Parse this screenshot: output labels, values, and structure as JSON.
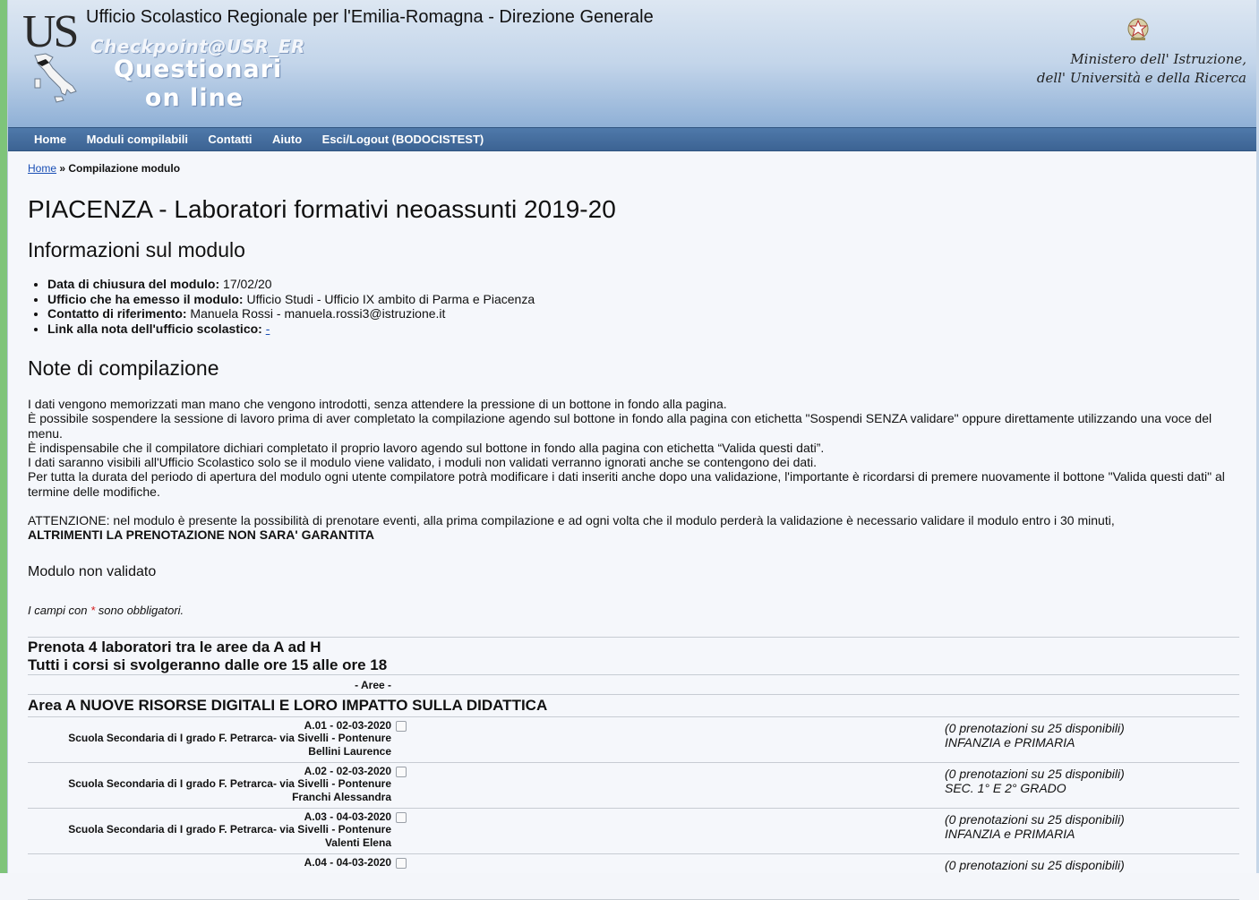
{
  "header": {
    "logo": "US",
    "title": "Ufficio Scolastico Regionale per l'Emilia-Romagna - Direzione Generale",
    "checkpoint": "Checkpoint@USR_ER",
    "questionari_line1": "Questionari",
    "questionari_line2": "on line",
    "ministero_line1": "Ministero dell' Istruzione,",
    "ministero_line2": "dell' Università e della Ricerca"
  },
  "nav": {
    "items": [
      "Home",
      "Moduli compilabili",
      "Contatti",
      "Aiuto",
      "Esci/Logout (BODOCISTEST)"
    ]
  },
  "breadcrumb": {
    "home": "Home",
    "separator": " » ",
    "current": "Compilazione modulo"
  },
  "page_title": "PIACENZA - Laboratori formativi neoassunti 2019-20",
  "info": {
    "heading": "Informazioni sul modulo",
    "items": [
      {
        "label": "Data di chiusura del modulo:",
        "value": " 17/02/20"
      },
      {
        "label": "Ufficio che ha emesso il modulo:",
        "value": " Ufficio Studi - Ufficio IX ambito di Parma e Piacenza"
      },
      {
        "label": "Contatto di riferimento:",
        "value": " Manuela Rossi - manuela.rossi3@istruzione.it"
      },
      {
        "label": "Link alla nota dell'ufficio scolastico:",
        "value": " ",
        "link": "-"
      }
    ]
  },
  "notes": {
    "heading": "Note di compilazione",
    "paragraphs": [
      "I dati vengono memorizzati man mano che vengono introdotti, senza attendere la pressione di un bottone in fondo alla pagina.",
      "È possibile sospendere la sessione di lavoro prima di aver completato la compilazione agendo sul bottone in fondo alla pagina con etichetta \"Sospendi SENZA validare\" oppure direttamente utilizzando una voce del menu.",
      "È indispensabile che il compilatore dichiari completato il proprio lavoro agendo sul bottone in fondo alla pagina con etichetta “Valida questi dati”.",
      "I dati saranno visibili all'Ufficio Scolastico solo se il modulo viene validato, i moduli non validati verranno ignorati anche se contengono dei dati.",
      "Per tutta la durata del periodo di apertura del modulo ogni utente compilatore potrà modificare i dati inseriti anche dopo una validazione, l'importante è ricordarsi di premere nuovamente il bottone \"Valida questi dati\" al termine delle modifiche."
    ],
    "attenzione": "ATTENZIONE: nel modulo è presente la possibilità di prenotare eventi, alla prima compilazione e ad ogni volta che il modulo perderà la validazione è necessario validare il modulo entro i 30 minuti,",
    "attenzione_bold": "ALTRIMENTI LA PRENOTAZIONE NON SARA' GARANTITA"
  },
  "status": "Modulo non validato",
  "required": {
    "prefix": "I campi con ",
    "star": "*",
    "suffix": " sono obbligatori."
  },
  "section": {
    "title_line1": "Prenota 4 laboratori tra le aree da A ad H",
    "title_line2": "Tutti i corsi si svolgeranno dalle ore 15 alle ore 18",
    "aree_label": "- Aree -",
    "area_title": "Area A NUOVE RISORSE DIGITALI E LORO IMPATTO SULLA DIDATTICA",
    "rows": [
      {
        "code": "A.01 - 02-03-2020",
        "school": "Scuola Secondaria di I grado F. Petrarca- via Sivelli - Pontenure",
        "teacher": "Bellini Laurence",
        "availability": "(0 prenotazioni su 25 disponibili)",
        "level": "INFANZIA e PRIMARIA"
      },
      {
        "code": "A.02 - 02-03-2020",
        "school": "Scuola Secondaria di I grado F. Petrarca- via Sivelli - Pontenure",
        "teacher": "Franchi Alessandra",
        "availability": "(0 prenotazioni su 25 disponibili)",
        "level": "SEC. 1° E 2° GRADO"
      },
      {
        "code": "A.03 - 04-03-2020",
        "school": "Scuola Secondaria di I grado F. Petrarca- via Sivelli - Pontenure",
        "teacher": "Valenti Elena",
        "availability": "(0 prenotazioni su 25 disponibili)",
        "level": "INFANZIA e PRIMARIA"
      },
      {
        "code": "A.04 - 04-03-2020",
        "school": "",
        "teacher": "",
        "availability": "(0 prenotazioni su 25 disponibili)",
        "level": ""
      }
    ]
  }
}
